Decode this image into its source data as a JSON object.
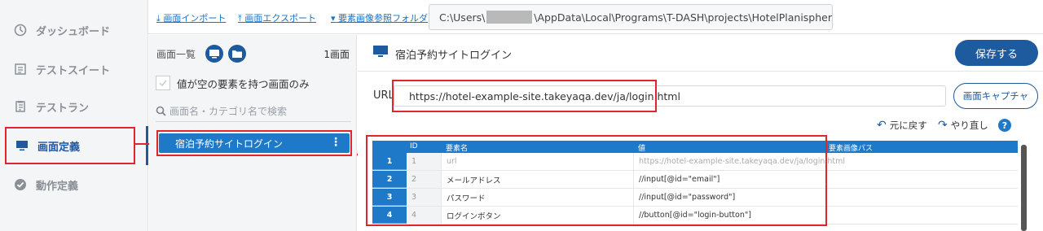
{
  "nav": {
    "items": [
      {
        "label": "ダッシュボード",
        "icon": "dashboard-icon"
      },
      {
        "label": "テストスイート",
        "icon": "test-suite-icon"
      },
      {
        "label": "テストラン",
        "icon": "test-run-icon"
      },
      {
        "label": "画面定義",
        "icon": "monitor-icon"
      },
      {
        "label": "動作定義",
        "icon": "check-circle-icon"
      }
    ]
  },
  "topbar": {
    "import_label": "画面インポート",
    "export_label": "画面エクスポート",
    "folder_label": "要素画像参照フォルダ",
    "path_prefix": "C:\\Users\\",
    "path_suffix": "\\AppData\\Local\\Programs\\T-DASH\\projects\\HotelPlanispher"
  },
  "screen_list": {
    "title": "画面一覧",
    "count": "1画面",
    "filter_label": "値が空の要素を持つ画面のみ",
    "search_placeholder": "画面名・カテゴリ名で検索",
    "items": [
      {
        "label": "宿泊予約サイトログイン"
      }
    ]
  },
  "screen": {
    "title": "宿泊予約サイトログイン",
    "save_label": "保存する",
    "url_label": "URL",
    "url_value": "https://hotel-example-site.takeyaqa.dev/ja/login.html",
    "capture_label": "画面キャプチャ",
    "undo_label": "元に戻す",
    "redo_label": "やり直し",
    "help_label": "?"
  },
  "table": {
    "columns": [
      "ID",
      "要素名",
      "値",
      "要素画像パス"
    ],
    "rows": [
      {
        "num": "1",
        "id": "1",
        "name": "url",
        "value": "https://hotel-example-site.takeyaqa.dev/ja/login.html",
        "path": ""
      },
      {
        "num": "2",
        "id": "2",
        "name": "メールアドレス",
        "value": "//input[@id=\"email\"]",
        "path": ""
      },
      {
        "num": "3",
        "id": "3",
        "name": "パスワード",
        "value": "//input[@id=\"password\"]",
        "path": ""
      },
      {
        "num": "4",
        "id": "4",
        "name": "ログインボタン",
        "value": "//button[@id=\"login-button\"]",
        "path": ""
      }
    ]
  },
  "colors": {
    "accent": "#1e5a9e",
    "accent_light": "#1e79c9",
    "highlight_red": "#e0262d"
  }
}
